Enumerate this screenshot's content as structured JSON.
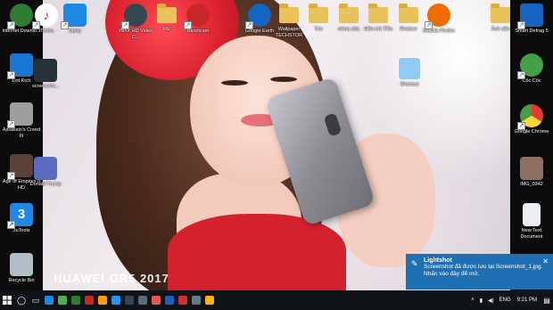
{
  "desktop": {
    "icons_left_col": [
      {
        "name": "Internet Downlo...",
        "color": "#2e7d32"
      },
      {
        "name": "Dot Kich",
        "color": "#1976d2"
      },
      {
        "name": "Assassin's Creed III",
        "color": "#9e9e9e"
      },
      {
        "name": "Age of Empires II HD",
        "color": "#5d4037"
      },
      {
        "name": "3uTools",
        "color": "#1e88e5"
      },
      {
        "name": "Recycle Bin",
        "color": "#b0bec5"
      }
    ],
    "icons_top_row": [
      {
        "name": "iTunes",
        "color": "#ffffff"
      },
      {
        "name": "Uplay",
        "color": "#1e88e5"
      },
      {
        "name": "WinX HD Video C...",
        "color": "#37474f"
      },
      {
        "name": "RE",
        "color": "#e8c25a"
      },
      {
        "name": "Bandicam",
        "color": "#c62828"
      },
      {
        "name": "Google Earth",
        "color": "#1565c0"
      },
      {
        "name": "Wallpaper TECHSTOR",
        "color": "#e8c25a"
      },
      {
        "name": "Trio",
        "color": "#e8c25a"
      },
      {
        "name": "china sữa",
        "color": "#e8c25a"
      },
      {
        "name": "Hiền nhi Tiền",
        "color": "#e8c25a"
      },
      {
        "name": "Restore",
        "color": "#e8c25a"
      },
      {
        "name": "Mozilla Firefox",
        "color": "#ef6c00"
      },
      {
        "name": "Ảnh nền",
        "color": "#e8c25a"
      }
    ],
    "icon_screenshot": "screensho...",
    "icon_donald": "Donald Trump",
    "icon_shortcut": "Shortcut",
    "icons_right_col": [
      {
        "name": "Smart Defrag 5",
        "color": "#1565c0"
      },
      {
        "name": "Cốc Cốc",
        "color": "#43a047"
      },
      {
        "name": "Google Chrome",
        "color": "#e53935"
      },
      {
        "name": "IMG_0342",
        "color": "#8d6e63"
      },
      {
        "name": "New Text Document",
        "color": "#eceff1"
      }
    ],
    "wallpaper_brand": "HUAWEI GR5 2017"
  },
  "notification": {
    "app": "Lightshot",
    "message": "Screenshot đã được lưu tại Screenshot_1.jpg. Nhấn vào đây để mở.",
    "close": "✕"
  },
  "taskbar": {
    "apps": [
      "#1e88e5",
      "#4caf50",
      "#2e7d32",
      "#c62828",
      "#ffa000",
      "#2196f3",
      "#37474f",
      "#546e7a",
      "#ef5350",
      "#1565c0",
      "#d32f2f",
      "#607d8b",
      "#ffb300"
    ],
    "tray": {
      "language": "ENG",
      "time": "9:21 PM"
    }
  },
  "colors": {
    "taskbar_bg": "#101418",
    "toast_bg": "#1f6fb3"
  }
}
